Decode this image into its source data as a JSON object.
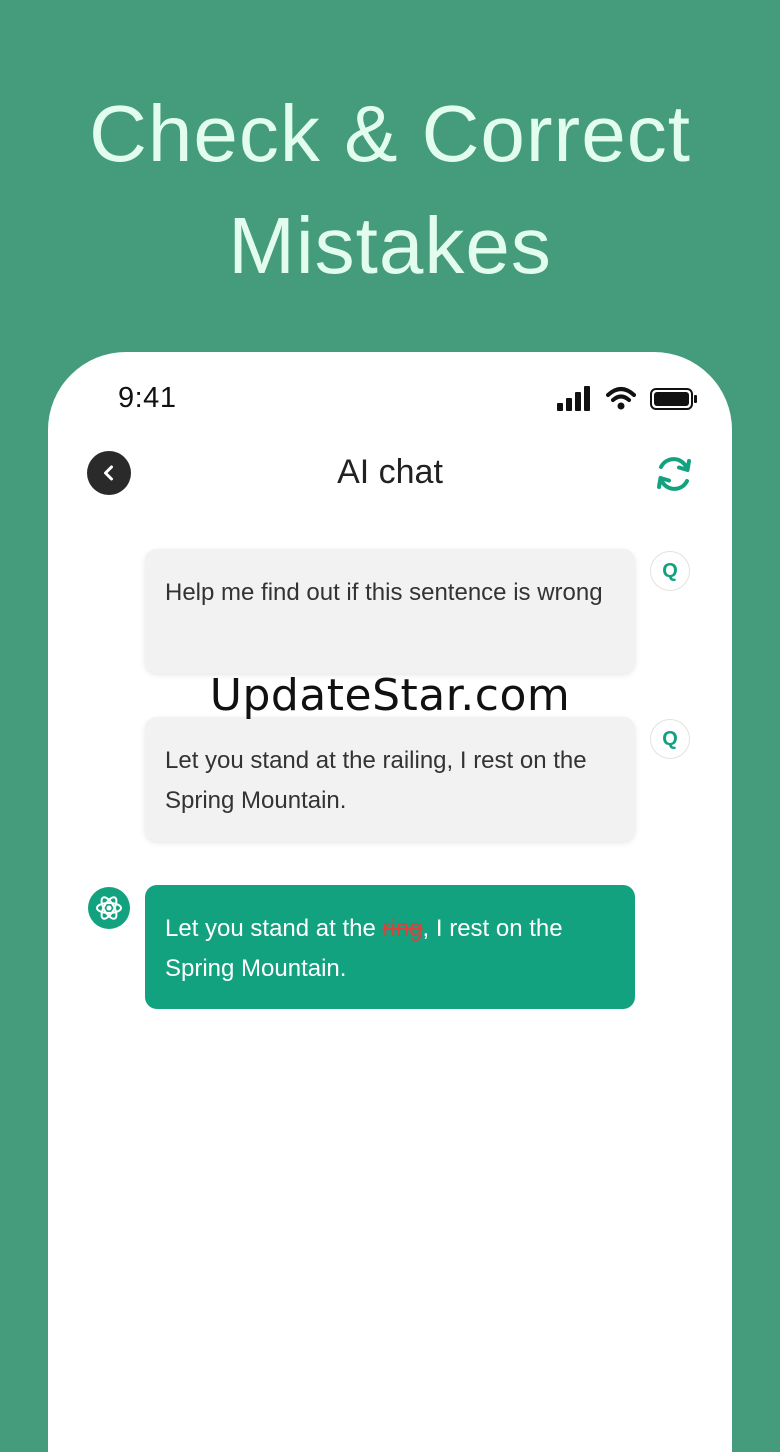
{
  "headline": {
    "line1": "Check & Correct",
    "line2": "Mistakes"
  },
  "status_bar": {
    "time": "9:41",
    "icons": [
      "signal-icon",
      "wifi-icon",
      "battery-icon"
    ]
  },
  "nav": {
    "title": "AI chat",
    "back_icon": "chevron-left-icon",
    "refresh_icon": "refresh-icon"
  },
  "messages": [
    {
      "role": "user",
      "badge": "Q",
      "text": "Help me find out if this sentence is wrong"
    },
    {
      "role": "user",
      "badge": "Q",
      "text": "Let you stand at the railing, I rest on the Spring Mountain."
    },
    {
      "role": "ai",
      "avatar_icon": "atom-icon",
      "text_before": "Let you stand at the ",
      "struck_word": "ring",
      "text_after": ", I rest on the Spring Mountain."
    }
  ],
  "watermark": "UpdateStar.com",
  "colors": {
    "background": "#449c7c",
    "headline": "#e2fcee",
    "accent": "#13a27f",
    "error": "#e0403a"
  }
}
